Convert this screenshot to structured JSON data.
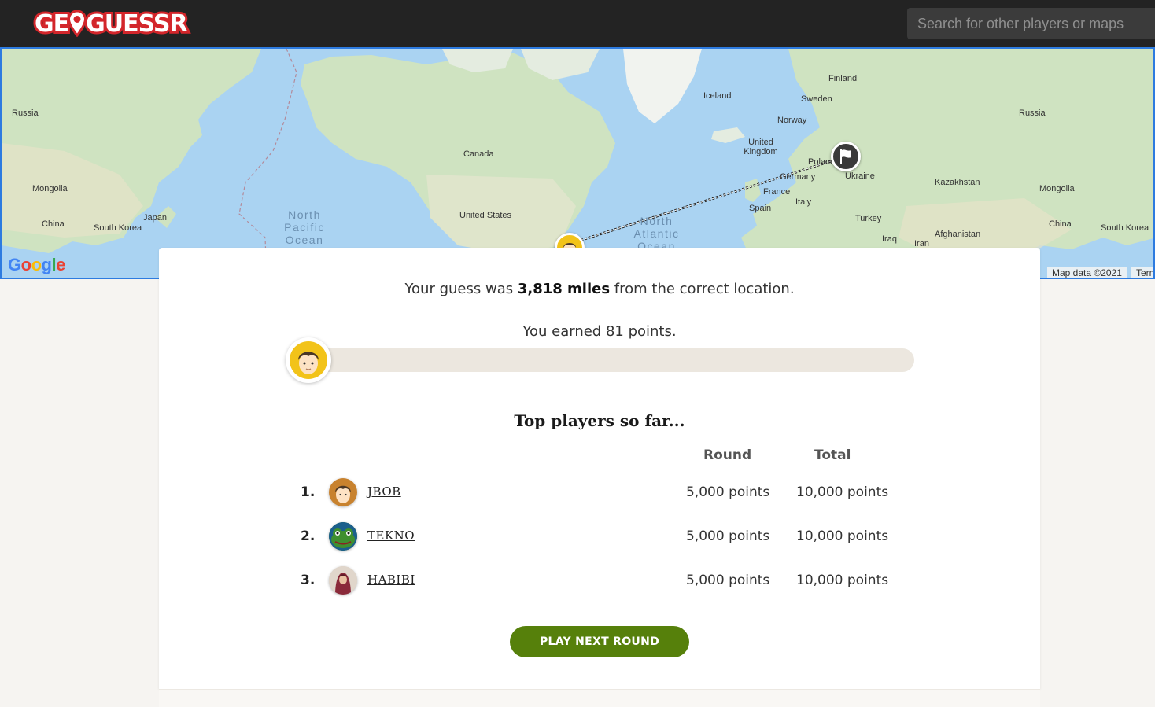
{
  "header": {
    "logo_text_left": "GE",
    "logo_text_right": "GUESSR",
    "search_placeholder": "Search for other players or maps"
  },
  "map": {
    "labels": {
      "russia_west": "Russia",
      "russia_east": "Russia",
      "mongolia_west": "Mongolia",
      "mongolia_east": "Mongolia",
      "china_west": "China",
      "china_east": "China",
      "south_korea_west": "South Korea",
      "south_korea_east": "South Korea",
      "japan": "Japan",
      "canada": "Canada",
      "united_states": "United States",
      "iceland": "Iceland",
      "finland": "Finland",
      "sweden": "Sweden",
      "norway": "Norway",
      "united_kingdom": "United Kingdom",
      "poland": "Poland",
      "germany": "Germany",
      "ukraine": "Ukraine",
      "france": "France",
      "italy": "Italy",
      "spain": "Spain",
      "turkey": "Turkey",
      "kazakhstan": "Kazakhstan",
      "afghanistan": "Afghanistan",
      "iraq": "Iraq",
      "iran": "Iran",
      "north_pacific": "North Pacific Ocean",
      "north_atlantic": "North Atlantic Ocean"
    },
    "google": "Google",
    "attribution": "Map data ©2021",
    "terms": "Terms"
  },
  "result": {
    "distance_prefix": "Your guess was ",
    "distance_value": "3,818 miles",
    "distance_suffix": " from the correct location.",
    "earned_text": "You earned 81 points.",
    "score_fraction": 0.0162
  },
  "leaderboard": {
    "title": "Top players so far...",
    "col_round": "Round",
    "col_total": "Total",
    "rows": [
      {
        "rank": "1.",
        "name": "JBOB",
        "round": "5,000 points",
        "total": "10,000 points"
      },
      {
        "rank": "2.",
        "name": "TEKNO",
        "round": "5,000 points",
        "total": "10,000 points"
      },
      {
        "rank": "3.",
        "name": "HABIBI",
        "round": "5,000 points",
        "total": "10,000 points"
      }
    ]
  },
  "play_button": "PLAY NEXT ROUND",
  "colors": {
    "brand_red": "#d3262b",
    "button_green": "#56800b",
    "marker_yellow": "#f2c319",
    "header_bg": "#232323"
  }
}
